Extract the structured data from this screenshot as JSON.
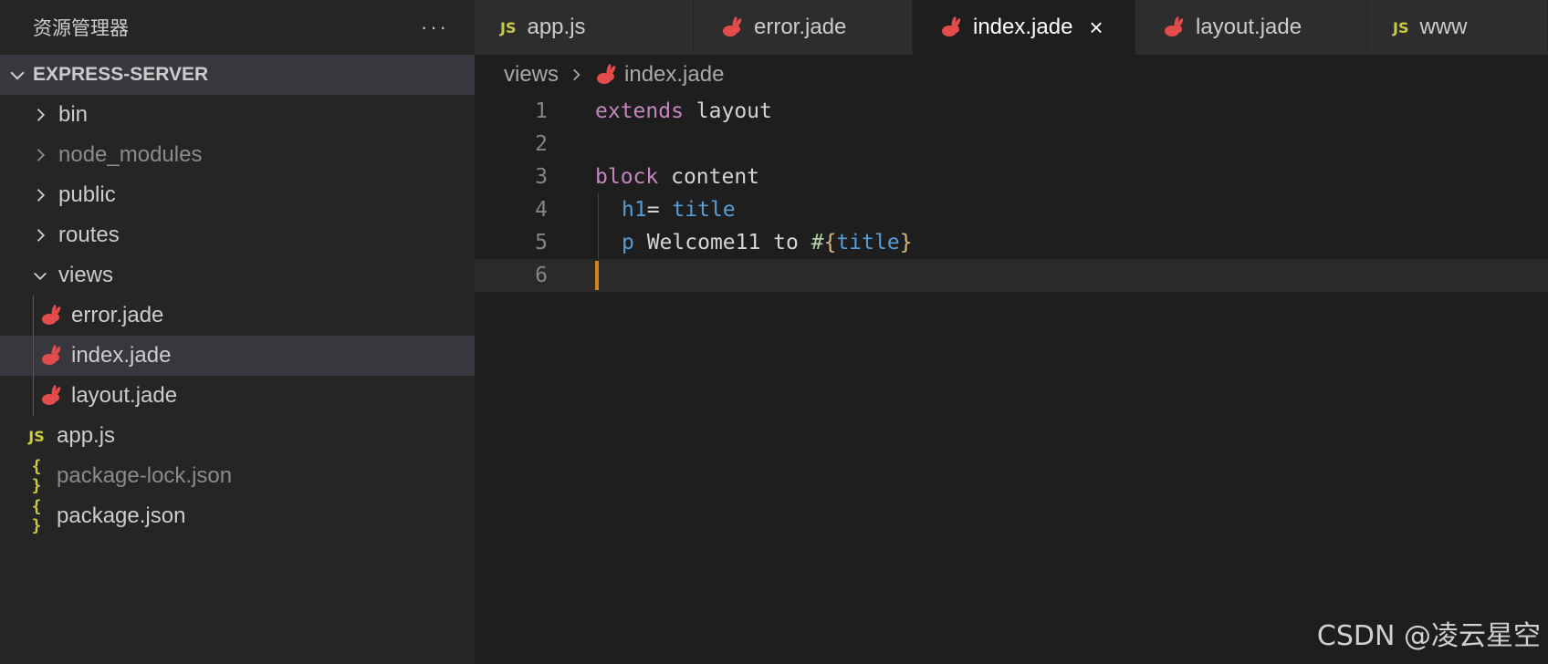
{
  "explorer": {
    "title": "资源管理器",
    "more": "···",
    "project": "EXPRESS-SERVER",
    "items": [
      {
        "label": "bin"
      },
      {
        "label": "node_modules"
      },
      {
        "label": "public"
      },
      {
        "label": "routes"
      },
      {
        "label": "views"
      },
      {
        "label": "error.jade"
      },
      {
        "label": "index.jade"
      },
      {
        "label": "layout.jade"
      },
      {
        "label": "app.js"
      },
      {
        "label": "package-lock.json"
      },
      {
        "label": "package.json"
      }
    ],
    "js_icon": "JS",
    "json_icon": "{ }"
  },
  "tabs": [
    {
      "label": "app.js",
      "icon": "JS"
    },
    {
      "label": "error.jade"
    },
    {
      "label": "index.jade",
      "close": "×"
    },
    {
      "label": "layout.jade"
    },
    {
      "label": "www",
      "icon": "JS"
    }
  ],
  "breadcrumb": {
    "folder": "views",
    "file": "index.jade"
  },
  "editor": {
    "line_numbers": [
      "1",
      "2",
      "3",
      "4",
      "5",
      "6"
    ],
    "l1_kw": "extends",
    "l1_rest": " layout",
    "l3_kw": "block",
    "l3_rest": " content",
    "l4_tag": "h1",
    "l4_eq": "= ",
    "l4_var": "title",
    "l5_tag": "p",
    "l5_text": " Welcome11 to ",
    "l5_hash": "#",
    "l5_open": "{",
    "l5_var": "title",
    "l5_close": "}"
  },
  "watermark": "CSDN @凌云星空",
  "colors": {
    "sidebar_bg": "#252526",
    "editor_bg": "#1e1e1e",
    "jade_icon": "#e34c4c",
    "js_icon": "#cbcb41",
    "keyword": "#c586c0",
    "tag": "#569cd6",
    "cursor": "#d18616"
  }
}
